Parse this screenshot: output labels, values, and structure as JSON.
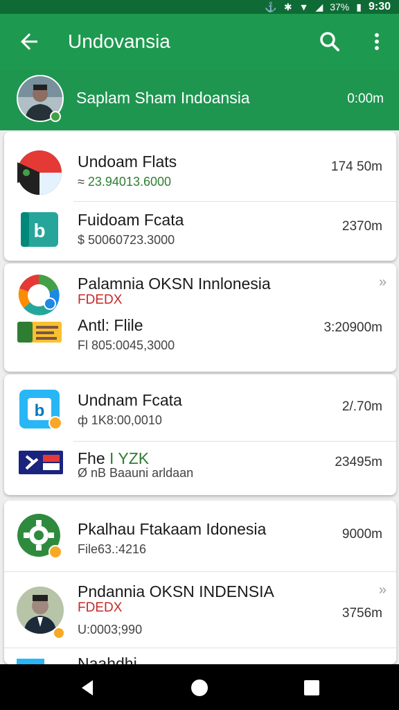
{
  "status": {
    "battery": "37%",
    "time": "9:30"
  },
  "appbar": {
    "title": "Undovansia"
  },
  "chat": {
    "name": "Saplam Sham Indoansia",
    "meta": "0:00m"
  },
  "rows": [
    {
      "title": "Undoam Flats",
      "sub_prefix": "≈ ",
      "sub": "23.94013.6000",
      "right": "174 50m"
    },
    {
      "title": "Fuidoam Fcata",
      "sub": "$ 50060723.3000",
      "right": "2370m"
    },
    {
      "title": "Palamnia OKSN Innlonesia",
      "tag": "FDEDX",
      "chevron": "»"
    },
    {
      "title": "Antl: Flile",
      "sub": "Fl 805:0045,3000",
      "right": "3:20900m"
    },
    {
      "title": "Undnam Fcata",
      "sub": "ф 1K8:00,0010",
      "right": "2/.70m"
    },
    {
      "title_a": "Fhe ",
      "title_b": "I YZK",
      "sub": "Ø nB Baauni arldaan",
      "right": "23495m"
    },
    {
      "title": "Pkalhau Ftakaam Idonesia",
      "sub": "File63.:4216",
      "right": "9000m"
    },
    {
      "title": "Pndannia OKSN INDENSIA",
      "tag": "FDEDX",
      "sub": "U:0003;990",
      "right": "3756m",
      "chevron": "»"
    },
    {
      "title": "Naahdhi.."
    }
  ],
  "colors": {
    "appbar": "#1d9a4f",
    "statusbar": "#0f6b36",
    "accent_red": "#c62828",
    "accent_green": "#2e7d32"
  },
  "icons": [
    "back-arrow-icon",
    "search-icon",
    "more-vert-icon",
    "back-triangle-icon",
    "home-circle-icon",
    "recents-square-icon"
  ]
}
